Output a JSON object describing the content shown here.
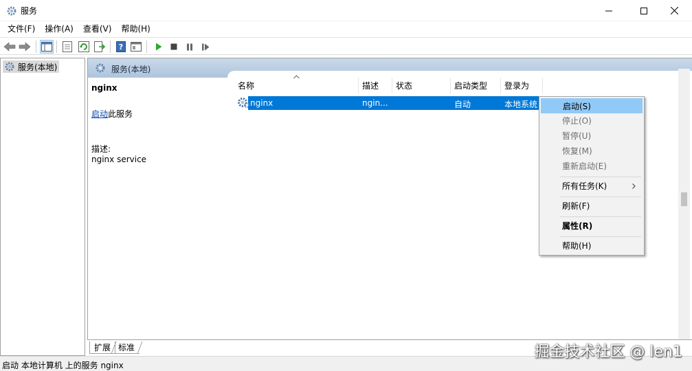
{
  "window": {
    "title": "服务",
    "icons": [
      "gear-icon",
      "minimize-icon",
      "maximize-icon",
      "close-icon"
    ]
  },
  "menubar": {
    "items": [
      "文件(F)",
      "操作(A)",
      "查看(V)",
      "帮助(H)"
    ]
  },
  "toolbar": {
    "icons": [
      "back-arrow-icon",
      "forward-arrow-icon",
      "console-tree-icon",
      "properties-sheet-icon",
      "refresh-icon",
      "export-list-icon",
      "help-icon",
      "view-icon",
      "play-icon",
      "stop-icon",
      "pause-icon",
      "resume-icon"
    ]
  },
  "tree": {
    "root_label": "服务(本地)"
  },
  "panel": {
    "header_title": "服务(本地)",
    "service_name": "nginx",
    "start_link": "启动",
    "start_suffix": "此服务",
    "desc_label": "描述:",
    "desc_value": "nginx service"
  },
  "list": {
    "columns": [
      "名称",
      "描述",
      "状态",
      "启动类型",
      "登录为"
    ],
    "sort_indicator": "^",
    "selected_row": {
      "name": "nginx",
      "desc": "ngin...",
      "status": "",
      "startup": "自动",
      "logon": "本地系统"
    }
  },
  "context_menu": {
    "items": [
      {
        "label": "启动(S)",
        "state": "highlighted"
      },
      {
        "label": "停止(O)",
        "state": "disabled"
      },
      {
        "label": "暂停(U)",
        "state": "disabled"
      },
      {
        "label": "恢复(M)",
        "state": "disabled"
      },
      {
        "label": "重新启动(E)",
        "state": "disabled"
      },
      {
        "label": "所有任务(K)",
        "state": "submenu"
      },
      {
        "label": "刷新(F)",
        "state": "normal"
      },
      {
        "label": "属性(R)",
        "state": "bold"
      },
      {
        "label": "帮助(H)",
        "state": "normal"
      }
    ]
  },
  "tabs": {
    "items": [
      "扩展",
      "标准"
    ]
  },
  "statusbar": {
    "text": "启动 本地计算机 上的服务 nginx"
  },
  "watermark": "掘金技术社区 @ len1",
  "colors": {
    "selection": "#0078d7",
    "menu_highlight": "#91c9f7",
    "header_gradient_top": "#c9d9ea",
    "header_gradient_bottom": "#aec4dc",
    "link": "#0645ad"
  }
}
